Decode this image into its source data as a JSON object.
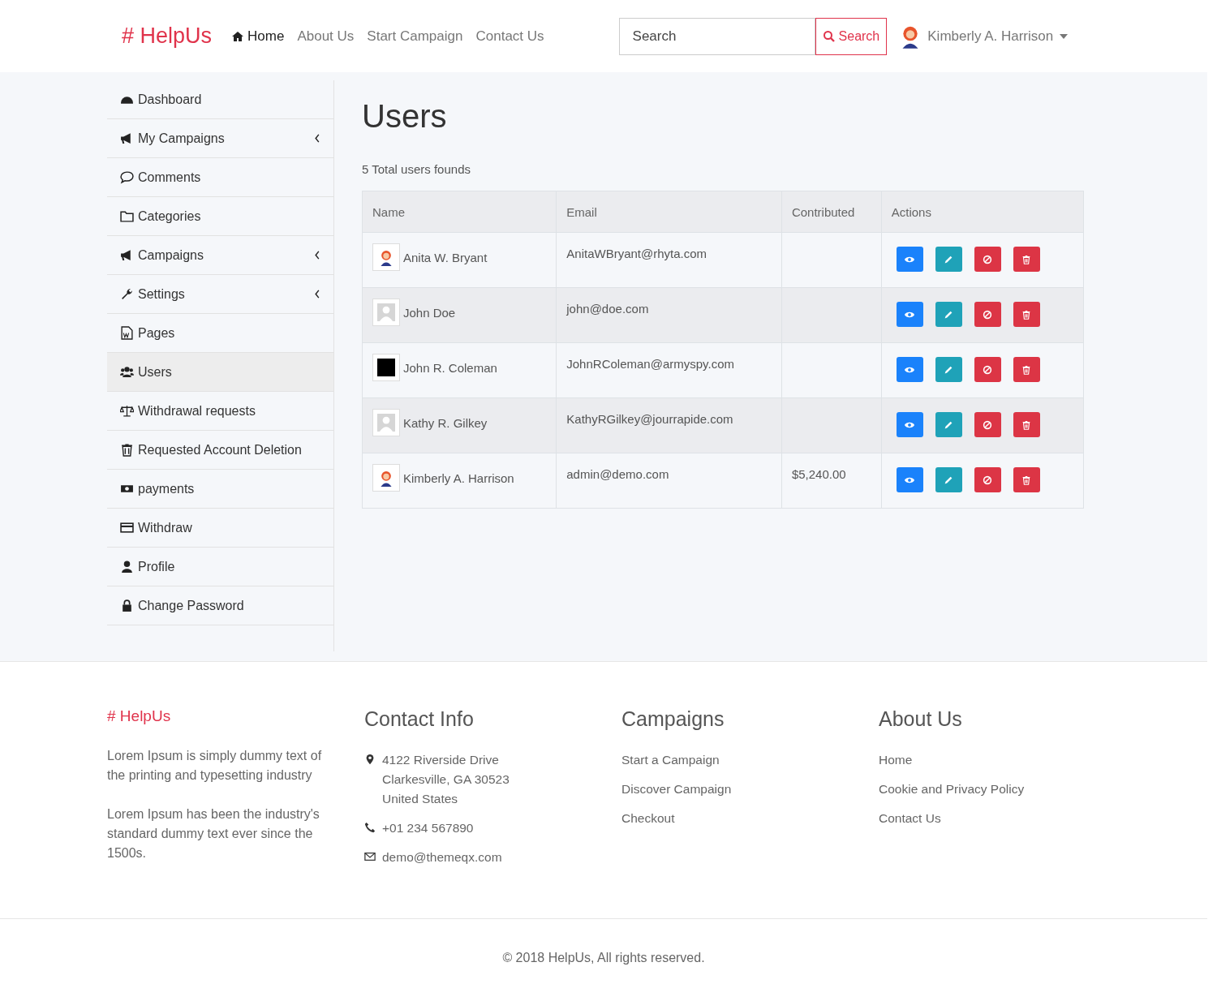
{
  "header": {
    "logo": "# HelpUs",
    "nav": [
      {
        "label": "Home",
        "selected": true
      },
      {
        "label": "About Us",
        "selected": false
      },
      {
        "label": "Start Campaign",
        "selected": false
      },
      {
        "label": "Contact Us",
        "selected": false
      }
    ],
    "search": {
      "placeholder": "Search",
      "button": "Search"
    },
    "user": {
      "name": "Kimberly A. Harrison"
    }
  },
  "sidebar": {
    "items": [
      {
        "label": "Dashboard",
        "submenu": false,
        "selected": false
      },
      {
        "label": "My Campaigns",
        "submenu": true,
        "selected": false
      },
      {
        "label": "Comments",
        "submenu": false,
        "selected": false
      },
      {
        "label": "Categories",
        "submenu": false,
        "selected": false
      },
      {
        "label": "Campaigns",
        "submenu": true,
        "selected": false
      },
      {
        "label": "Settings",
        "submenu": true,
        "selected": false
      },
      {
        "label": "Pages",
        "submenu": false,
        "selected": false
      },
      {
        "label": "Users",
        "submenu": false,
        "selected": true
      },
      {
        "label": "Withdrawal requests",
        "submenu": false,
        "selected": false
      },
      {
        "label": "Requested Account Deletion",
        "submenu": false,
        "selected": false
      },
      {
        "label": "payments",
        "submenu": false,
        "selected": false
      },
      {
        "label": "Withdraw",
        "submenu": false,
        "selected": false
      },
      {
        "label": "Profile",
        "submenu": false,
        "selected": false
      },
      {
        "label": "Change Password",
        "submenu": false,
        "selected": false
      }
    ]
  },
  "main": {
    "title": "Users",
    "count": "5 Total users founds",
    "table": {
      "columns": [
        "Name",
        "Email",
        "Contributed",
        "Actions"
      ],
      "rows": [
        {
          "kind": "cartoon",
          "name": "Anita W. Bryant",
          "email": "AnitaWBryant@rhyta.com"
        },
        {
          "kind": "placeholder",
          "name": "John Doe",
          "email": "john@doe.com"
        },
        {
          "kind": "photo",
          "name": "John R. Coleman",
          "email": "JohnRColeman@armyspy.com"
        },
        {
          "kind": "placeholder",
          "name": "Kathy R. Gilkey",
          "email": "KathyRGilkey@jourrapide.com"
        },
        {
          "kind": "cartoon",
          "name": "Kimberly A. Harrison",
          "email": "admin@demo.com",
          "contributed": "$5,240.00"
        }
      ]
    }
  },
  "footer": {
    "logo": "# HelpUs",
    "about": [
      "Lorem Ipsum is simply dummy text of the printing and typesetting industry",
      "Lorem Ipsum has been the industry's standard dummy text ever since the 1500s."
    ],
    "contact": {
      "title": "Contact Info",
      "items": [
        {
          "kind": "address",
          "lines": [
            "4122 Riverside Drive",
            "Clarkesville, GA 30523",
            "United States"
          ]
        },
        {
          "kind": "phone",
          "lines": [
            "+01 234 567890"
          ]
        },
        {
          "kind": "email",
          "lines": [
            "demo@themeqx.com"
          ]
        }
      ]
    },
    "campaigns": {
      "title": "Campaigns",
      "links": [
        "Start a Campaign",
        "Discover Campaign",
        "Checkout"
      ]
    },
    "about_us": {
      "title": "About Us",
      "links": [
        "Home",
        "Cookie and Privacy Policy",
        "Contact Us"
      ]
    },
    "copyright": "© 2018 HelpUs, All rights reserved."
  }
}
